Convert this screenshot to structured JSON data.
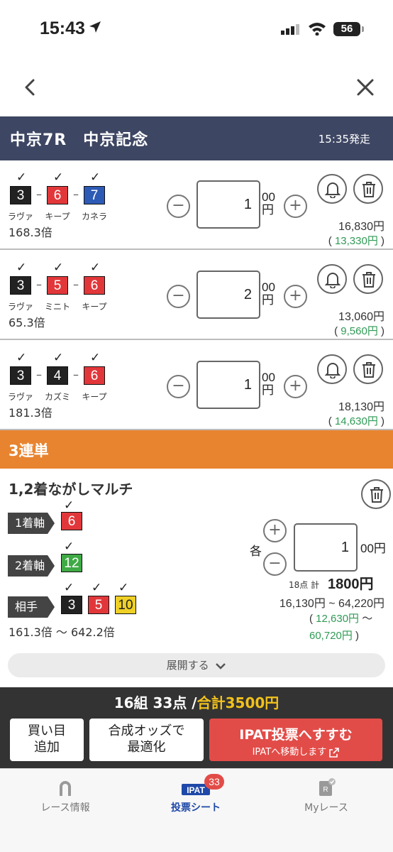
{
  "status": {
    "time": "15:43",
    "battery": "56"
  },
  "race": {
    "title": "中京7R　中京記念",
    "post_time": "15:35発走"
  },
  "bets": [
    {
      "horses": [
        {
          "num": "3",
          "name": "ラヴァ",
          "color": "#222222"
        },
        {
          "num": "6",
          "name": "キープ",
          "color": "#e2373a"
        },
        {
          "num": "7",
          "name": "カネラ",
          "color": "#2d5ab5"
        }
      ],
      "odds": "168.3倍",
      "amount": "1",
      "unit_top": "00",
      "unit_bottom": "円",
      "payout": "16,830円",
      "profit": "13,330円"
    },
    {
      "horses": [
        {
          "num": "3",
          "name": "ラヴァ",
          "color": "#222222"
        },
        {
          "num": "5",
          "name": "ミニト",
          "color": "#e2373a"
        },
        {
          "num": "6",
          "name": "キープ",
          "color": "#e2373a"
        }
      ],
      "odds": "65.3倍",
      "amount": "2",
      "unit_top": "00",
      "unit_bottom": "円",
      "payout": "13,060円",
      "profit": "9,560円"
    },
    {
      "horses": [
        {
          "num": "3",
          "name": "ラヴァ",
          "color": "#222222"
        },
        {
          "num": "4",
          "name": "カズミ",
          "color": "#222222"
        },
        {
          "num": "6",
          "name": "キープ",
          "color": "#e2373a"
        }
      ],
      "odds": "181.3倍",
      "amount": "1",
      "unit_top": "00",
      "unit_bottom": "円",
      "payout": "18,130円",
      "profit": "14,630円"
    }
  ],
  "section": {
    "title": "3連単"
  },
  "multi": {
    "title": "1,2着ながしマルチ",
    "axis1_label": "1着軸",
    "axis1_horse": "6",
    "axis2_label": "2着軸",
    "axis2_horse": "12",
    "partner_label": "相手",
    "partners": [
      "3",
      "5",
      "10"
    ],
    "odds_range": "161.3倍 〜 642.2倍",
    "each_label": "各",
    "amount": "1",
    "unit": "00円",
    "points_label": "18点 計",
    "total": "1800円",
    "payout_range": "16,130円 ~ 64,220円",
    "profit_line1": "12,630円",
    "profit_line2": "60,720円"
  },
  "expand_label": "展開する",
  "summary": {
    "left": "16組 33点 /",
    "total": "合計3500円"
  },
  "actions": {
    "add_line1": "買い目",
    "add_line2": "追加",
    "optimize_line1": "合成オッズで",
    "optimize_line2": "最適化",
    "ipat_main": "IPAT投票へすすむ",
    "ipat_sub": "IPATへ移動します"
  },
  "tabs": [
    {
      "label": "レース情報",
      "icon": "horseshoe-icon"
    },
    {
      "label": "投票シート",
      "icon": "ipat-icon",
      "badge": "33",
      "icon_text": "IPAT"
    },
    {
      "label": "Myレース",
      "icon": "my-race-icon"
    }
  ]
}
